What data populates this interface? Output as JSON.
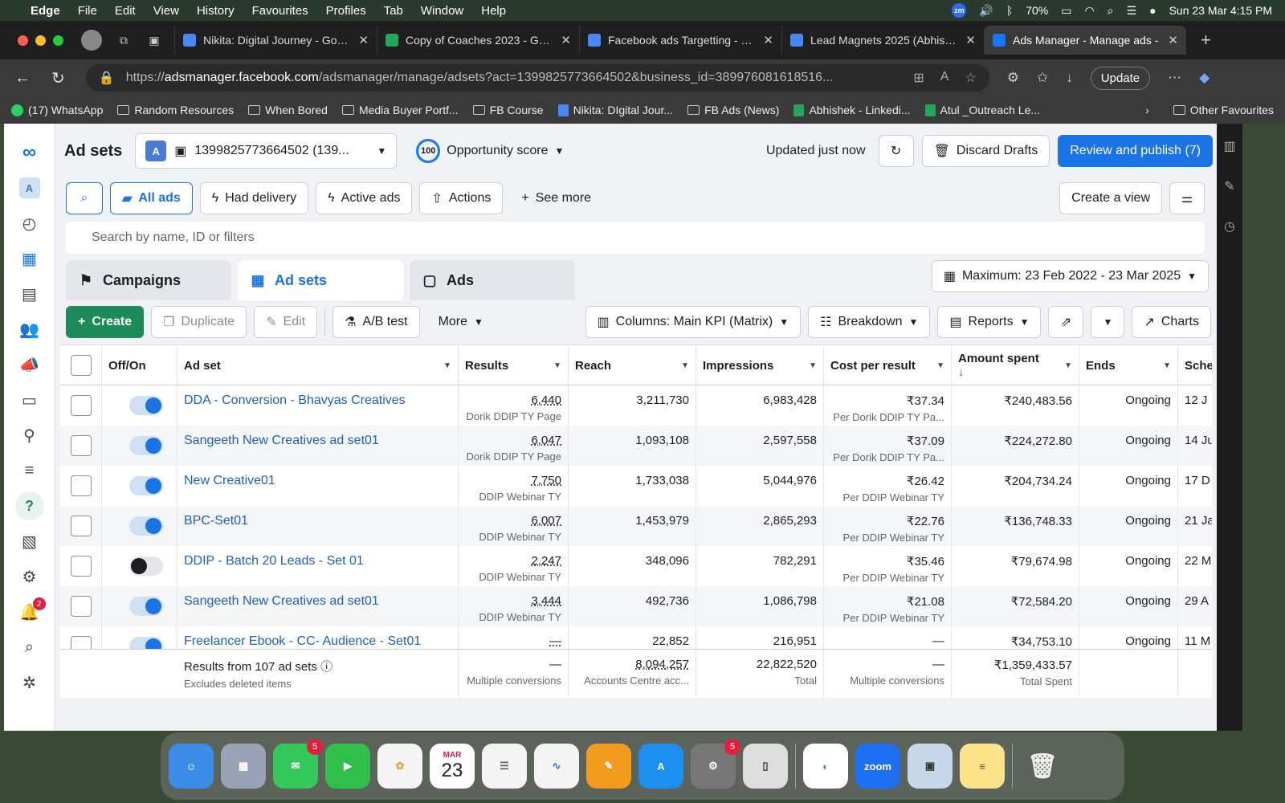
{
  "mac_menu": {
    "app": "Edge",
    "items": [
      "File",
      "Edit",
      "View",
      "History",
      "Favourites",
      "Profiles",
      "Tab",
      "Window",
      "Help"
    ],
    "zoom_badge": "zm",
    "battery": "70%",
    "datetime": "Sun 23 Mar  4:15 PM"
  },
  "tabs": [
    {
      "title": "Nikita: Digital Journey - Google",
      "favicon_color": "#4a86f5"
    },
    {
      "title": "Copy of Coaches 2023 - Google",
      "favicon_color": "#23a55a"
    },
    {
      "title": "Facebook ads Targetting - Google",
      "favicon_color": "#4a86f5"
    },
    {
      "title": "Lead Magnets 2025 (Abhishek",
      "favicon_color": "#4a86f5"
    },
    {
      "title": "Ads Manager - Manage ads -",
      "favicon_color": "#1877f2"
    }
  ],
  "address": {
    "protocol": "https://",
    "host": "adsmanager.facebook.com",
    "path": "/adsmanager/manage/adsets?act=1399825773664502&business_id=389976081618516...",
    "update_label": "Update"
  },
  "bookmarks": [
    {
      "label": "(17) WhatsApp",
      "icon": "wa"
    },
    {
      "label": "Random Resources",
      "icon": "folder"
    },
    {
      "label": "When Bored",
      "icon": "folder"
    },
    {
      "label": "Media Buyer Portf...",
      "icon": "folder"
    },
    {
      "label": "FB Course",
      "icon": "folder"
    },
    {
      "label": "Nikita: DIgital Jour...",
      "icon": "g-doc"
    },
    {
      "label": "FB Ads (News)",
      "icon": "folder"
    },
    {
      "label": "Abhishek - Linkedi...",
      "icon": "g-sheet"
    },
    {
      "label": "Atul _Outreach Le...",
      "icon": "g-sheet"
    }
  ],
  "bookmarks_other": "Other Favourites",
  "leftnav": {
    "account_letter": "A",
    "notification_count": "2"
  },
  "header": {
    "title": "Ad sets",
    "account_letter": "A",
    "account_label": "1399825773664502 (139...",
    "opportunity_score_value": "100",
    "opportunity_label": "Opportunity score",
    "updated": "Updated just now",
    "discard": "Discard Drafts",
    "review": "Review and publish (7)"
  },
  "filters": {
    "all_ads": "All ads",
    "had_delivery": "Had delivery",
    "active_ads": "Active ads",
    "actions": "Actions",
    "see_more": "See more",
    "create_view": "Create a view",
    "search_placeholder": "Search by name, ID or filters"
  },
  "level_tabs": {
    "campaigns": "Campaigns",
    "adsets": "Ad sets",
    "ads": "Ads",
    "date_range": "Maximum: 23 Feb 2022 - 23 Mar 2025"
  },
  "toolbar": {
    "create": "Create",
    "duplicate": "Duplicate",
    "edit": "Edit",
    "ab_test": "A/B test",
    "more": "More",
    "columns": "Columns: Main KPI (Matrix)",
    "breakdown": "Breakdown",
    "reports": "Reports",
    "charts": "Charts"
  },
  "table": {
    "headers": {
      "offon": "Off/On",
      "adset": "Ad set",
      "results": "Results",
      "reach": "Reach",
      "impressions": "Impressions",
      "cpr": "Cost per result",
      "spent": "Amount spent",
      "ends": "Ends",
      "schedule": "Sche"
    },
    "rows": [
      {
        "name": "DDA - Conversion - Bhavyas Creatives",
        "on": true,
        "results": "6,440",
        "results_sub": "Dorik DDIP TY Page",
        "reach": "3,211,730",
        "impressions": "6,983,428",
        "cpr": "₹37.34",
        "cpr_sub": "Per Dorik DDIP TY Pa...",
        "spent": "₹240,483.56",
        "ends": "Ongoing",
        "schedule": "12 J"
      },
      {
        "name": "Sangeeth New Creatives ad set01",
        "on": true,
        "results": "6,047",
        "results_sub": "Dorik DDIP TY Page",
        "reach": "1,093,108",
        "impressions": "2,597,558",
        "cpr": "₹37.09",
        "cpr_sub": "Per Dorik DDIP TY Pa...",
        "spent": "₹224,272.80",
        "ends": "Ongoing",
        "schedule": "14 Ju"
      },
      {
        "name": "New Creative01",
        "on": true,
        "results": "7,750",
        "results_sub": "DDIP Webinar TY",
        "reach": "1,733,038",
        "impressions": "5,044,976",
        "cpr": "₹26.42",
        "cpr_sub": "Per DDIP Webinar TY",
        "spent": "₹204,734.24",
        "ends": "Ongoing",
        "schedule": "17 D"
      },
      {
        "name": "BPC-Set01",
        "on": true,
        "results": "6,007",
        "results_sub": "DDIP Webinar TY",
        "reach": "1,453,979",
        "impressions": "2,865,293",
        "cpr": "₹22.76",
        "cpr_sub": "Per DDIP Webinar TY",
        "spent": "₹136,748.33",
        "ends": "Ongoing",
        "schedule": "21 Ja"
      },
      {
        "name": "DDIP - Batch 20 Leads - Set 01",
        "on": false,
        "results": "2,247",
        "results_sub": "DDIP Webinar TY",
        "reach": "348,096",
        "impressions": "782,291",
        "cpr": "₹35.46",
        "cpr_sub": "Per DDIP Webinar TY",
        "spent": "₹79,674.98",
        "ends": "Ongoing",
        "schedule": "22 M"
      },
      {
        "name": "Sangeeth New Creatives ad set01",
        "on": true,
        "results": "3,444",
        "results_sub": "DDIP Webinar TY",
        "reach": "492,736",
        "impressions": "1,086,798",
        "cpr": "₹21.08",
        "cpr_sub": "Per DDIP Webinar TY",
        "spent": "₹72,584.20",
        "ends": "Ongoing",
        "schedule": "29 A"
      },
      {
        "name": "Freelancer Ebook - CC- Audience - Set01",
        "on": true,
        "results": "—",
        "results_sub": "",
        "reach": "22,852",
        "impressions": "216,951",
        "cpr": "—",
        "cpr_sub": "",
        "spent": "₹34,753.10",
        "ends": "Ongoing",
        "schedule": "11 M"
      }
    ],
    "footer": {
      "label": "Results from 107 ad sets",
      "sub": "Excludes deleted items",
      "results": "—",
      "results_sub": "Multiple conversions",
      "reach": "8,094,257",
      "reach_sub": "Accounts Centre acc...",
      "impressions": "22,822,520",
      "impressions_sub": "Total",
      "cpr": "—",
      "cpr_sub": "Multiple conversions",
      "spent": "₹1,359,433.57",
      "spent_sub": "Total Spent"
    }
  },
  "dock": {
    "messages_badge": "5",
    "calendar_month": "MAR",
    "calendar_day": "23",
    "settings_badge": "5",
    "zoom_label": "zoom"
  }
}
